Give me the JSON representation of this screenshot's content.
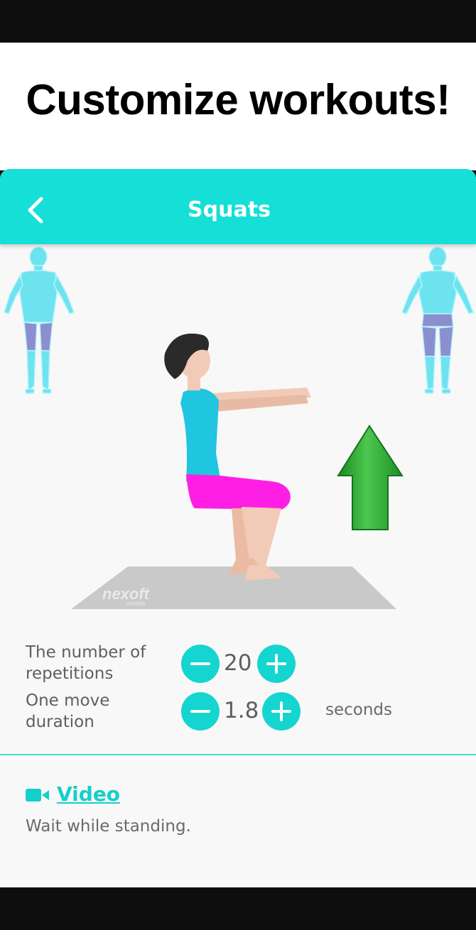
{
  "promo": {
    "title": "Customize workouts!"
  },
  "app_bar": {
    "title": "Squats",
    "back_icon": "chevron-left-icon",
    "color": "#15dfd6"
  },
  "illustration": {
    "mat_brand": "nexoft",
    "mat_brand_sub": "mobile",
    "arrow_direction": "up",
    "arrow_color": "#2eae35"
  },
  "settings": {
    "repetitions": {
      "label_line1": "The number of",
      "label_line2": "repetitions",
      "value": "20"
    },
    "duration": {
      "label_line1": "One move",
      "label_line2": "duration",
      "value": "1.8",
      "unit": "seconds"
    },
    "accent": "#15d5d0"
  },
  "info": {
    "video_label": "Video",
    "video_icon": "video-camera-icon",
    "description": "Wait while standing."
  }
}
